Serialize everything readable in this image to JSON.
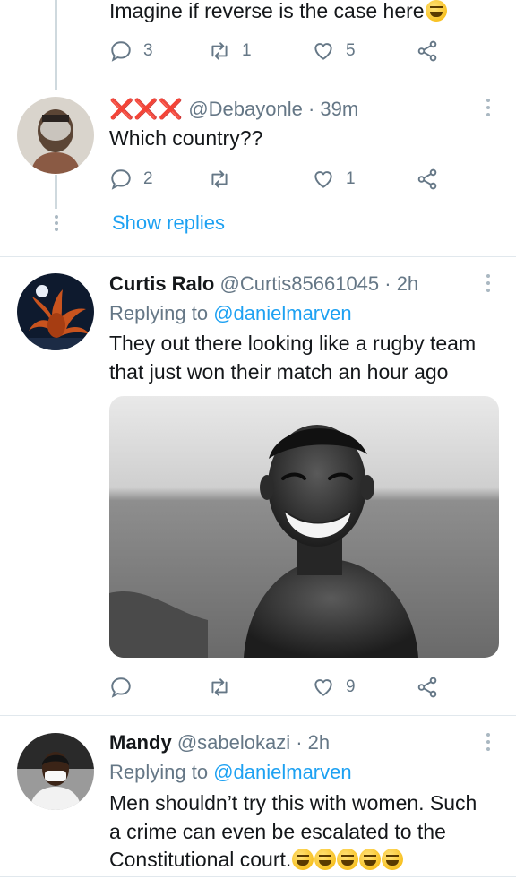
{
  "thread": {
    "top_tweet": {
      "text": "Imagine if reverse is the case here",
      "emoji": "face-with-tears-of-joy",
      "replies": "3",
      "retweets": "1",
      "likes": "5"
    },
    "reply_tweet": {
      "name": "❌❌❌",
      "handle": "@Debayonle · 39m",
      "text": "Which country??",
      "replies": "2",
      "retweets": "",
      "likes": "1"
    },
    "show_replies": "Show replies"
  },
  "tweets": [
    {
      "name": "Curtis Ralo",
      "handle": "@Curtis85661045 · 2h",
      "replying_prefix": "Replying to ",
      "replying_to": "@danielmarven",
      "line1": "They out there looking like a rugby team",
      "line2": "that just won their match an hour ago",
      "replies": "",
      "retweets": "",
      "likes": "9"
    },
    {
      "name": "Mandy",
      "handle": "@sabelokazi · 2h",
      "replying_prefix": "Replying to ",
      "replying_to": "@danielmarven",
      "line1": "Men shouldn’t try this with women. Such",
      "line2": "a crime can even be escalated to the",
      "line3": "Constitutional court.",
      "emoji": "rolling-on-the-floor-laughing x5"
    }
  ],
  "colors": {
    "accent": "#1da1f2",
    "muted": "#657786",
    "text": "#14171a",
    "divider": "#e1e8ed"
  }
}
